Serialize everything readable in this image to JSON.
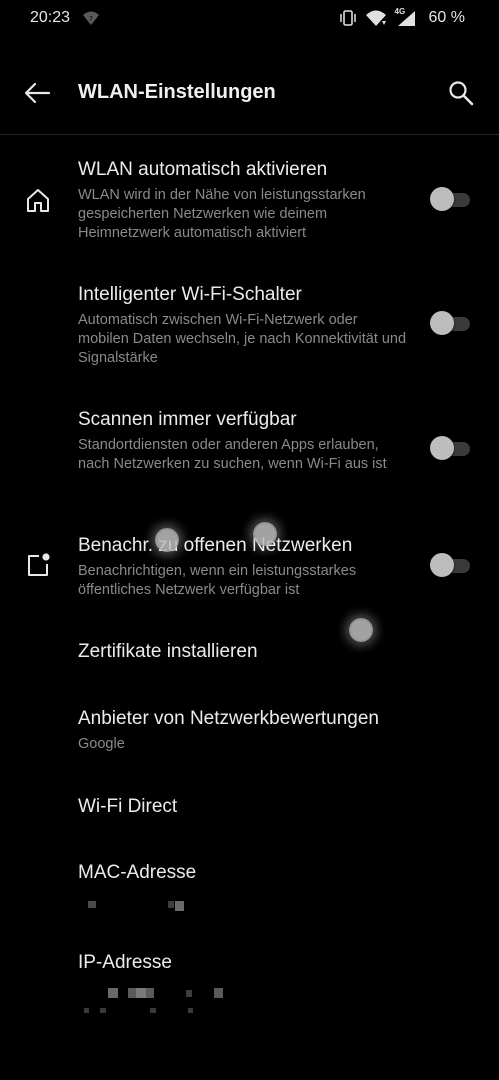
{
  "status_bar": {
    "time": "20:23",
    "battery": "60 %",
    "network": "4G",
    "icons": [
      "wifi-question-icon",
      "vibrate-icon",
      "wifi-icon",
      "cell-signal-icon"
    ]
  },
  "toolbar": {
    "title": "WLAN-Einstellungen",
    "back_icon": "back-arrow-icon",
    "search_icon": "search-icon"
  },
  "settings": [
    {
      "title": "WLAN automatisch aktivieren",
      "summary": "WLAN wird in der Nähe von leistungsstarken gespeicherten Netzwerken wie deinem Heimnetzwerk automatisch aktiviert",
      "icon": "home-icon",
      "toggle": false
    },
    {
      "title": "Intelligenter Wi-Fi-Schalter",
      "summary": "Automatisch zwischen Wi-Fi-Netzwerk oder mobilen Daten wechseln, je nach Konnektivität und Signalstärke",
      "toggle": false
    },
    {
      "title": "Scannen immer verfügbar",
      "summary": "Standortdiensten oder anderen Apps erlauben, nach Netzwerken zu suchen, wenn Wi-Fi aus ist",
      "toggle": false
    },
    {
      "title": "Benachr. zu offenen Netzwerken",
      "summary": "Benachrichtigen, wenn ein leistungsstarkes öffentliches Netzwerk verfügbar ist",
      "icon": "notification-badge-icon",
      "toggle": false
    },
    {
      "title": "Zertifikate installieren"
    },
    {
      "title": "Anbieter von Netzwerkbewertungen",
      "summary": "Google"
    },
    {
      "title": "Wi-Fi Direct"
    },
    {
      "title": "MAC-Adresse"
    },
    {
      "title": "IP-Adresse"
    }
  ]
}
